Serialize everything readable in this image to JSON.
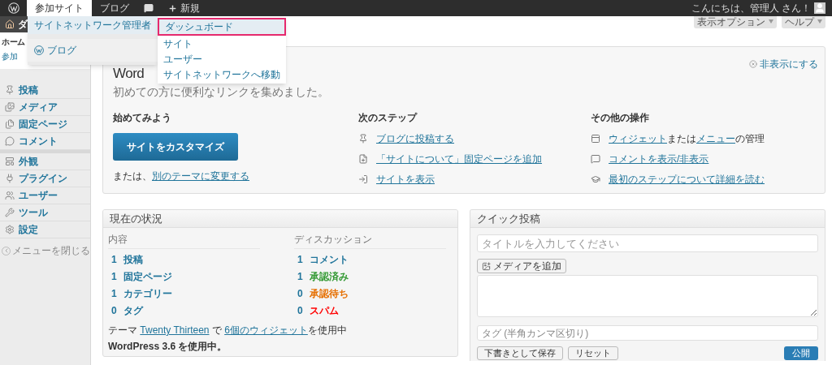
{
  "admin_bar": {
    "items": [
      {
        "kind": "logo",
        "selected": false
      },
      {
        "kind": "text",
        "label": "参加サイト",
        "selected": true
      },
      {
        "kind": "text",
        "label": "ブログ",
        "selected": false
      },
      {
        "kind": "comment",
        "selected": false
      },
      {
        "kind": "new",
        "label": "新規",
        "selected": false
      }
    ],
    "greeting": "こんにちは、管理人 さん！",
    "menu": [
      {
        "label": "サイトネットワーク管理者",
        "kind": "text",
        "selected": true,
        "children": [
          {
            "label": "ダッシュボード",
            "selected": true
          },
          {
            "label": "サイト",
            "selected": false
          },
          {
            "label": "ユーザー",
            "selected": false
          },
          {
            "label": "サイトネットワークへ移動",
            "selected": false
          }
        ]
      },
      {
        "label": "ブログ",
        "kind": "logo",
        "selected": false
      }
    ]
  },
  "sidebar": {
    "header": "ダ",
    "sub_items": [
      {
        "label": "ホーム",
        "selected": true
      },
      {
        "label": "参加",
        "selected": false
      }
    ],
    "items": [
      {
        "label": "投稿"
      },
      {
        "label": "メディア"
      },
      {
        "label": "固定ページ"
      },
      {
        "label": "コメント"
      },
      {
        "label": "外観"
      },
      {
        "label": "プラグイン"
      },
      {
        "label": "ユーザー"
      },
      {
        "label": "ツール"
      },
      {
        "label": "設定"
      }
    ],
    "collapse": "メニューを閉じる"
  },
  "screen_options": [
    "表示オプション",
    "ヘルプ"
  ],
  "welcome": {
    "title": "Word",
    "dismiss": "非表示にする",
    "subtitle": "初めての方に便利なリンクを集めました。",
    "start": {
      "heading": "始めてみよう",
      "button": "サイトをカスタマイズ",
      "or_text": "または、",
      "or_link": "別のテーマに変更する"
    },
    "next": {
      "heading": "次のステップ",
      "links": [
        "ブログに投稿する",
        "「サイトについて」固定ページを追加",
        "サイトを表示"
      ]
    },
    "more": {
      "heading": "その他の操作",
      "rows": [
        {
          "parts": [
            {
              "text": "ウィジェット",
              "link": true
            },
            {
              "text": "または",
              "link": false
            },
            {
              "text": "メニュー",
              "link": true
            },
            {
              "text": "の管理",
              "link": false
            }
          ]
        },
        {
          "parts": [
            {
              "text": "コメントを表示/非表示",
              "link": true
            }
          ]
        },
        {
          "parts": [
            {
              "text": "最初のステップについて詳細を読む",
              "link": true
            }
          ]
        }
      ]
    }
  },
  "right_now": {
    "title": "現在の状況",
    "content": {
      "heading": "内容",
      "rows": [
        {
          "count": "1",
          "label": "投稿",
          "color": "#21759b"
        },
        {
          "count": "1",
          "label": "固定ページ",
          "color": "#21759b"
        },
        {
          "count": "1",
          "label": "カテゴリー",
          "color": "#21759b"
        },
        {
          "count": "0",
          "label": "タグ",
          "color": "#21759b"
        }
      ]
    },
    "discussion": {
      "heading": "ディスカッション",
      "rows": [
        {
          "count": "1",
          "label": "コメント",
          "color": "#21759b"
        },
        {
          "count": "1",
          "label": "承認済み",
          "color": "#339933"
        },
        {
          "count": "0",
          "label": "承認待ち",
          "color": "#e66f00"
        },
        {
          "count": "0",
          "label": "スパム",
          "color": "#ff0000"
        }
      ]
    },
    "theme_line": [
      {
        "text": "テーマ ",
        "link": false
      },
      {
        "text": "Twenty Thirteen",
        "link": true
      },
      {
        "text": " で ",
        "link": false
      },
      {
        "text": "6個のウィジェット",
        "link": true
      },
      {
        "text": "を使用中",
        "link": false
      }
    ],
    "version": "WordPress 3.6 を使用中。"
  },
  "quick_press": {
    "title": "クイック投稿",
    "title_placeholder": "タイトルを入力してください",
    "media_button": "メディアを追加",
    "tags_placeholder": "タグ (半角カンマ区切り)",
    "buttons": [
      {
        "label": "下書きとして保存",
        "kind": "secondary"
      },
      {
        "label": "リセット",
        "kind": "secondary"
      },
      {
        "label": "公開",
        "kind": "primary"
      }
    ]
  }
}
